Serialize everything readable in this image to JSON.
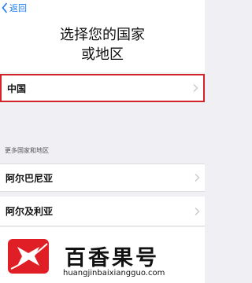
{
  "nav": {
    "back_label": "返回"
  },
  "title": {
    "line1": "选择您的国家",
    "line2": "或地区"
  },
  "selected_row": {
    "label": "中国"
  },
  "section": {
    "header": "更多国家和地区"
  },
  "countries": [
    {
      "label": "阿尔巴尼亚"
    },
    {
      "label": "阿尔及利亚"
    }
  ],
  "watermark": {
    "brand": "百香果号",
    "domain": "huangjinbaixiangguo.com"
  },
  "colors": {
    "accent": "#1a7cf5",
    "highlight_border": "#d2232a",
    "background": "#efeff4",
    "logo_red": "#e01e26"
  },
  "icons": {
    "back": "chevron-left-icon",
    "row": "chevron-right-icon",
    "logo": "brand-logo"
  }
}
